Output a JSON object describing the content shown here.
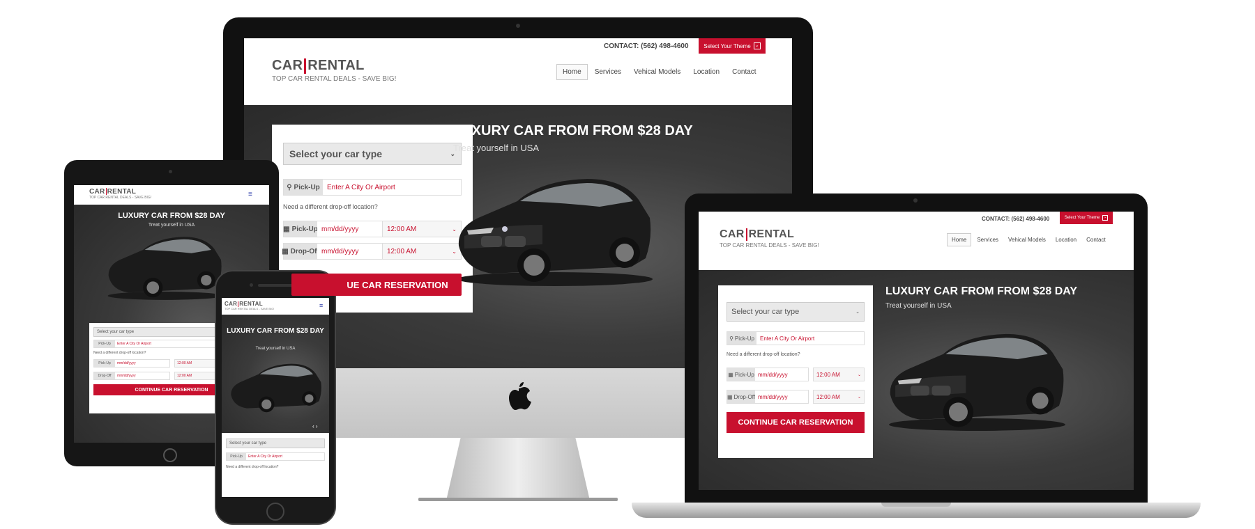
{
  "brand": {
    "logo_left": "CAR",
    "logo_right": "RENTAL",
    "tagline": "TOP CAR RENTAL DEALS - SAVE BIG!"
  },
  "contact": "CONTACT: (562) 498-4600",
  "theme_button": "Select Your Theme",
  "nav": [
    "Home",
    "Services",
    "Vehical Models",
    "Location",
    "Contact"
  ],
  "hero": {
    "title": "LUXURY CAR FROM FROM $28 DAY",
    "title_mobile": "LUXURY CAR FROM $28 DAY",
    "subtitle": "Treat yourself in USA"
  },
  "form": {
    "car_type_placeholder": "Select your car type",
    "pickup_label": "Pick-Up",
    "pickup_placeholder": "Enter A City Or Airport",
    "different_dropoff": "Need a different drop-off location?",
    "date_placeholder": "mm/dd/yyyy",
    "time_value": "12:00 AM",
    "dropoff_label": "Drop-Off",
    "submit": "CONTINUE CAR RESERVATION",
    "submit_partial": "UE CAR RESERVATION"
  },
  "colors": {
    "accent": "#c8102e",
    "hero_bg": "#3a3a3a"
  },
  "icons": {
    "pin": "map-pin-icon",
    "calendar": "calendar-icon",
    "menu": "hamburger-menu-icon",
    "apple": "apple-logo-icon",
    "chevron": "chevron-down-icon"
  }
}
